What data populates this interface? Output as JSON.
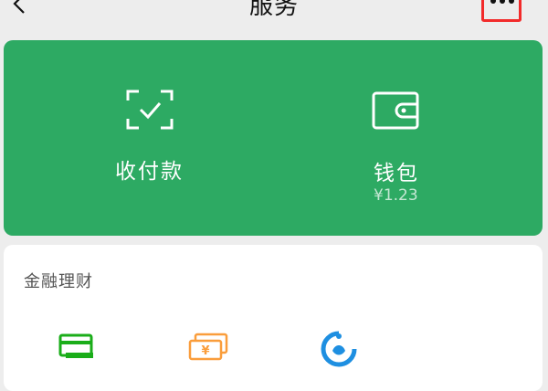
{
  "header": {
    "title": "服务",
    "back_icon": "chevron-left-icon",
    "more_icon": "more-dots-icon",
    "highlight_color": "#f22b2b"
  },
  "card": {
    "color": "#2daa63",
    "pay": {
      "label": "收付款",
      "icon": "scan-pay-icon"
    },
    "wallet": {
      "label": "钱包",
      "balance": "¥1.23",
      "icon": "wallet-icon"
    }
  },
  "section": {
    "title": "金融理财",
    "items": [
      {
        "icon": "credit-card-repay-icon",
        "color": "#1aad19"
      },
      {
        "icon": "wealth-money-icon",
        "color": "#fa9d3b"
      },
      {
        "icon": "fund-icon",
        "color": "#1e8fe1"
      }
    ]
  }
}
